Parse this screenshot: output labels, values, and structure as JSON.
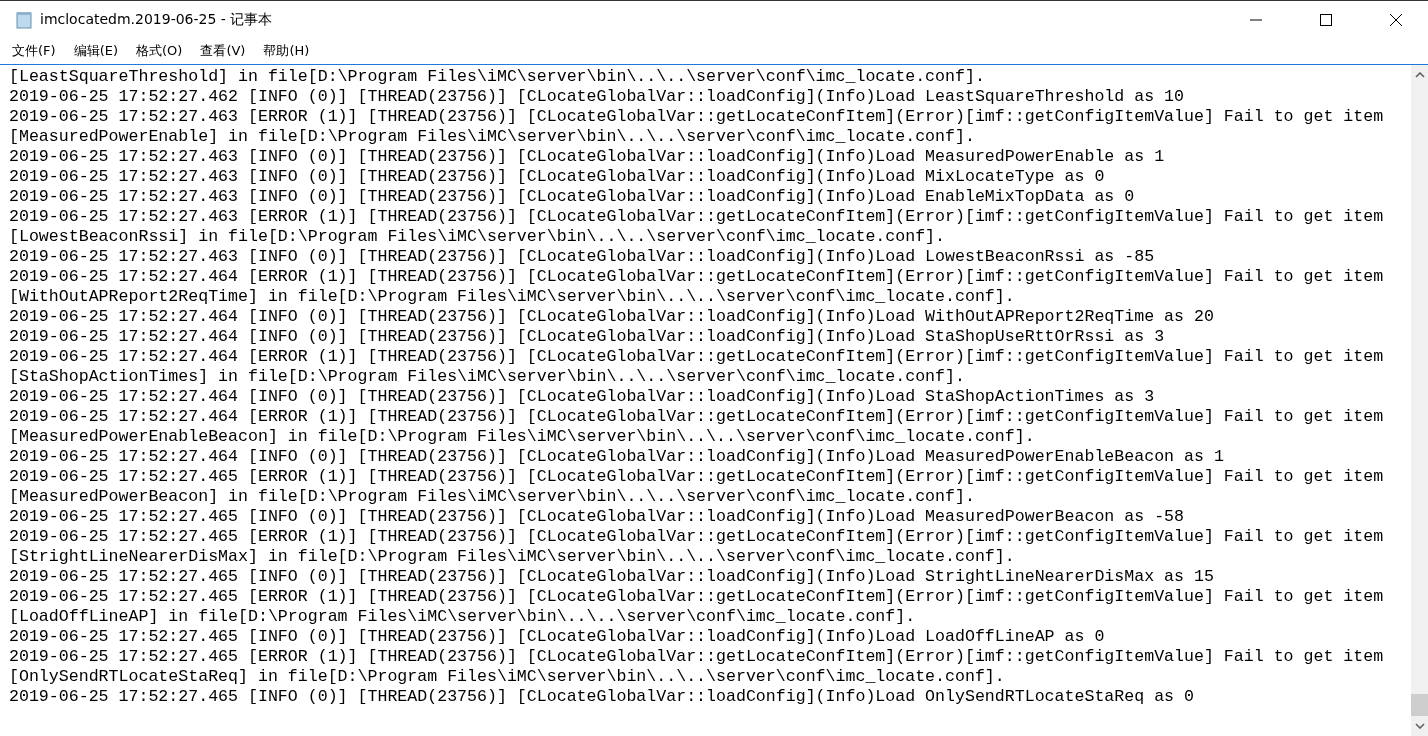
{
  "window": {
    "title": "imclocatedm.2019-06-25 - 记事本"
  },
  "menu": [
    "文件(F)",
    "编辑(E)",
    "格式(O)",
    "查看(V)",
    "帮助(H)"
  ],
  "lines": [
    "[LeastSquareThreshold] in file[D:\\Program Files\\iMC\\server\\bin\\..\\..\\server\\conf\\imc_locate.conf].",
    "2019-06-25 17:52:27.462 [INFO (0)] [THREAD(23756)] [CLocateGlobalVar::loadConfig](Info)Load LeastSquareThreshold as 10",
    "2019-06-25 17:52:27.463 [ERROR (1)] [THREAD(23756)] [CLocateGlobalVar::getLocateConfItem](Error)[imf::getConfigItemValue] Fail to get item",
    "[MeasuredPowerEnable] in file[D:\\Program Files\\iMC\\server\\bin\\..\\..\\server\\conf\\imc_locate.conf].",
    "2019-06-25 17:52:27.463 [INFO (0)] [THREAD(23756)] [CLocateGlobalVar::loadConfig](Info)Load MeasuredPowerEnable as 1",
    "2019-06-25 17:52:27.463 [INFO (0)] [THREAD(23756)] [CLocateGlobalVar::loadConfig](Info)Load MixLocateType as 0",
    "2019-06-25 17:52:27.463 [INFO (0)] [THREAD(23756)] [CLocateGlobalVar::loadConfig](Info)Load EnableMixTopData as 0",
    "2019-06-25 17:52:27.463 [ERROR (1)] [THREAD(23756)] [CLocateGlobalVar::getLocateConfItem](Error)[imf::getConfigItemValue] Fail to get item",
    "[LowestBeaconRssi] in file[D:\\Program Files\\iMC\\server\\bin\\..\\..\\server\\conf\\imc_locate.conf].",
    "2019-06-25 17:52:27.463 [INFO (0)] [THREAD(23756)] [CLocateGlobalVar::loadConfig](Info)Load LowestBeaconRssi as -85",
    "2019-06-25 17:52:27.464 [ERROR (1)] [THREAD(23756)] [CLocateGlobalVar::getLocateConfItem](Error)[imf::getConfigItemValue] Fail to get item",
    "[WithOutAPReport2ReqTime] in file[D:\\Program Files\\iMC\\server\\bin\\..\\..\\server\\conf\\imc_locate.conf].",
    "2019-06-25 17:52:27.464 [INFO (0)] [THREAD(23756)] [CLocateGlobalVar::loadConfig](Info)Load WithOutAPReport2ReqTime as 20",
    "2019-06-25 17:52:27.464 [INFO (0)] [THREAD(23756)] [CLocateGlobalVar::loadConfig](Info)Load StaShopUseRttOrRssi as 3",
    "2019-06-25 17:52:27.464 [ERROR (1)] [THREAD(23756)] [CLocateGlobalVar::getLocateConfItem](Error)[imf::getConfigItemValue] Fail to get item",
    "[StaShopActionTimes] in file[D:\\Program Files\\iMC\\server\\bin\\..\\..\\server\\conf\\imc_locate.conf].",
    "2019-06-25 17:52:27.464 [INFO (0)] [THREAD(23756)] [CLocateGlobalVar::loadConfig](Info)Load StaShopActionTimes as 3",
    "2019-06-25 17:52:27.464 [ERROR (1)] [THREAD(23756)] [CLocateGlobalVar::getLocateConfItem](Error)[imf::getConfigItemValue] Fail to get item",
    "[MeasuredPowerEnableBeacon] in file[D:\\Program Files\\iMC\\server\\bin\\..\\..\\server\\conf\\imc_locate.conf].",
    "2019-06-25 17:52:27.464 [INFO (0)] [THREAD(23756)] [CLocateGlobalVar::loadConfig](Info)Load MeasuredPowerEnableBeacon as 1",
    "2019-06-25 17:52:27.465 [ERROR (1)] [THREAD(23756)] [CLocateGlobalVar::getLocateConfItem](Error)[imf::getConfigItemValue] Fail to get item",
    "[MeasuredPowerBeacon] in file[D:\\Program Files\\iMC\\server\\bin\\..\\..\\server\\conf\\imc_locate.conf].",
    "2019-06-25 17:52:27.465 [INFO (0)] [THREAD(23756)] [CLocateGlobalVar::loadConfig](Info)Load MeasuredPowerBeacon as -58",
    "2019-06-25 17:52:27.465 [ERROR (1)] [THREAD(23756)] [CLocateGlobalVar::getLocateConfItem](Error)[imf::getConfigItemValue] Fail to get item",
    "[StrightLineNearerDisMax] in file[D:\\Program Files\\iMC\\server\\bin\\..\\..\\server\\conf\\imc_locate.conf].",
    "2019-06-25 17:52:27.465 [INFO (0)] [THREAD(23756)] [CLocateGlobalVar::loadConfig](Info)Load StrightLineNearerDisMax as 15",
    "2019-06-25 17:52:27.465 [ERROR (1)] [THREAD(23756)] [CLocateGlobalVar::getLocateConfItem](Error)[imf::getConfigItemValue] Fail to get item",
    "[LoadOffLineAP] in file[D:\\Program Files\\iMC\\server\\bin\\..\\..\\server\\conf\\imc_locate.conf].",
    "2019-06-25 17:52:27.465 [INFO (0)] [THREAD(23756)] [CLocateGlobalVar::loadConfig](Info)Load LoadOffLineAP as 0",
    "2019-06-25 17:52:27.465 [ERROR (1)] [THREAD(23756)] [CLocateGlobalVar::getLocateConfItem](Error)[imf::getConfigItemValue] Fail to get item",
    "[OnlySendRTLocateStaReq] in file[D:\\Program Files\\iMC\\server\\bin\\..\\..\\server\\conf\\imc_locate.conf].",
    "2019-06-25 17:52:27.465 [INFO (0)] [THREAD(23756)] [CLocateGlobalVar::loadConfig](Info)Load OnlySendRTLocateStaReq as 0"
  ]
}
